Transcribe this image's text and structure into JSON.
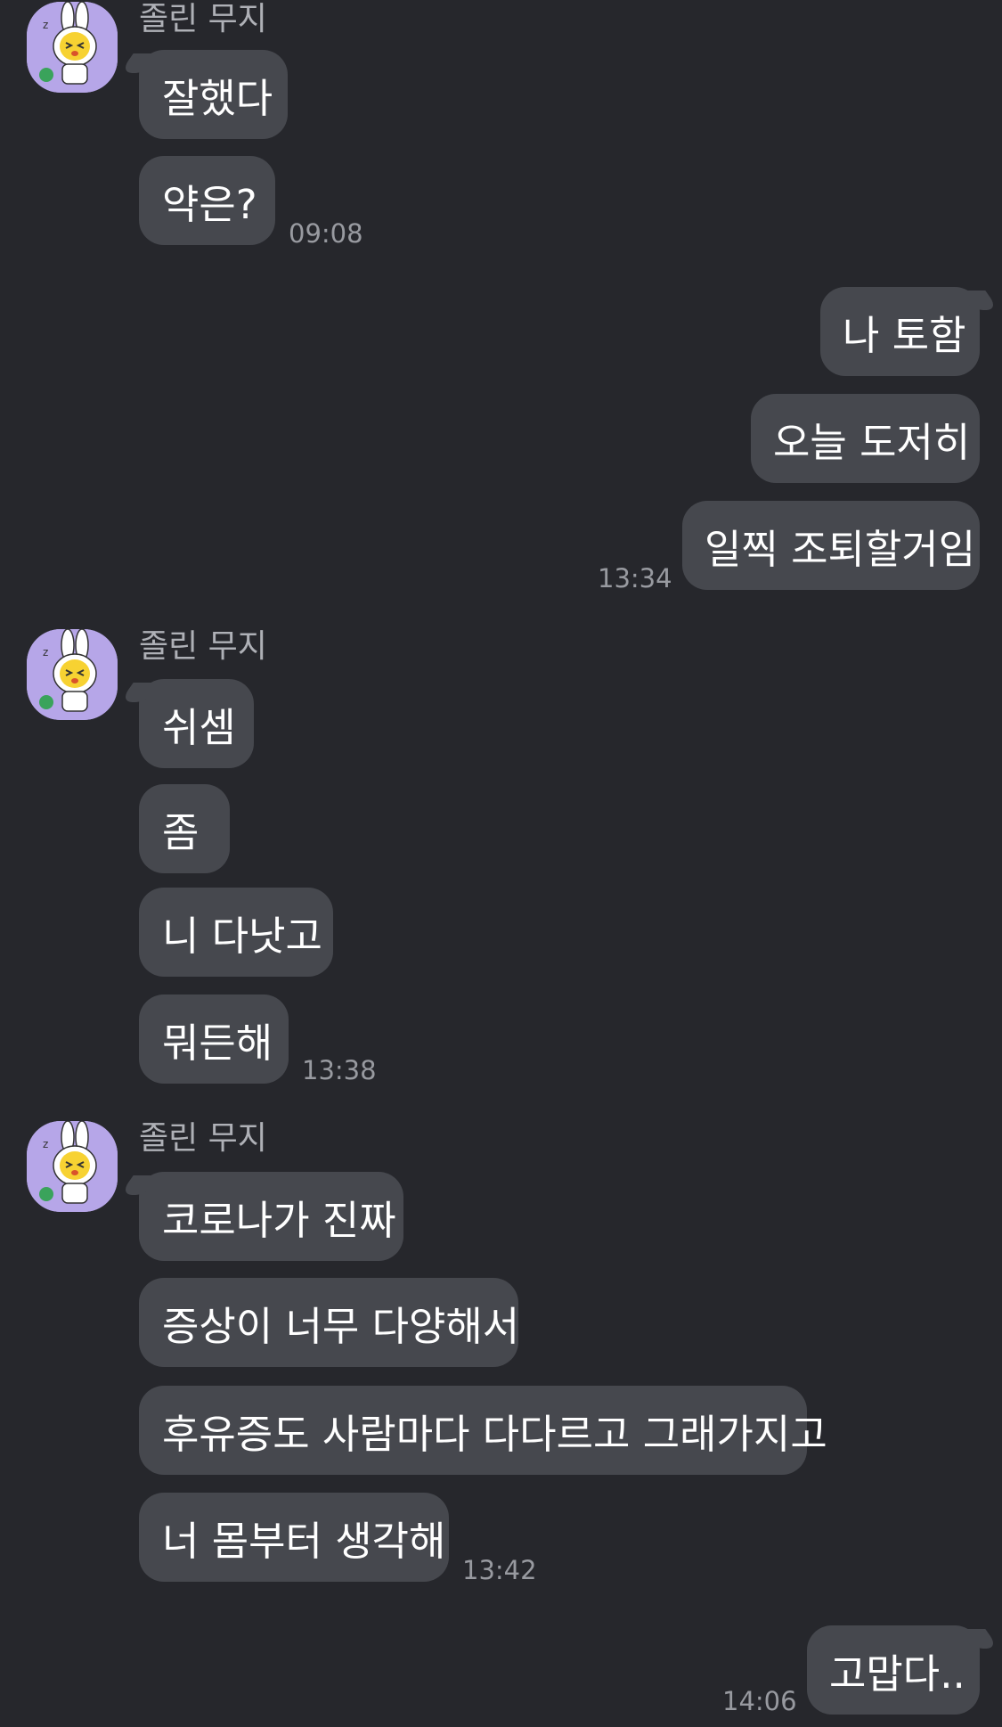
{
  "chat": {
    "sender_name": "졸린 무지",
    "groups": [
      {
        "side": "left",
        "messages": [
          "잘했다",
          "약은?"
        ],
        "time": "09:08"
      },
      {
        "side": "right",
        "messages": [
          "나 토함",
          "오늘 도저히",
          "일찍 조퇴할거임"
        ],
        "time": "13:34"
      },
      {
        "side": "left",
        "messages": [
          "쉬셈",
          "좀",
          "니 다낫고",
          "뭐든해"
        ],
        "time": "13:38"
      },
      {
        "side": "left",
        "messages": [
          "코로나가 진짜",
          "증상이 너무 다양해서",
          "후유증도 사람마다 다다르고 그래가지고",
          "너 몸부터 생각해"
        ],
        "time": "13:42"
      },
      {
        "side": "right",
        "messages": [
          "고맙다.."
        ],
        "time": "14:06"
      }
    ]
  },
  "colors": {
    "background": "#26272c",
    "bubble": "#46484e",
    "avatar_bg": "#b6a6e8",
    "sender_text": "#aeb0b6",
    "time_text": "#989aa0"
  },
  "icons": {
    "avatar": "muzi-character-avatar"
  }
}
